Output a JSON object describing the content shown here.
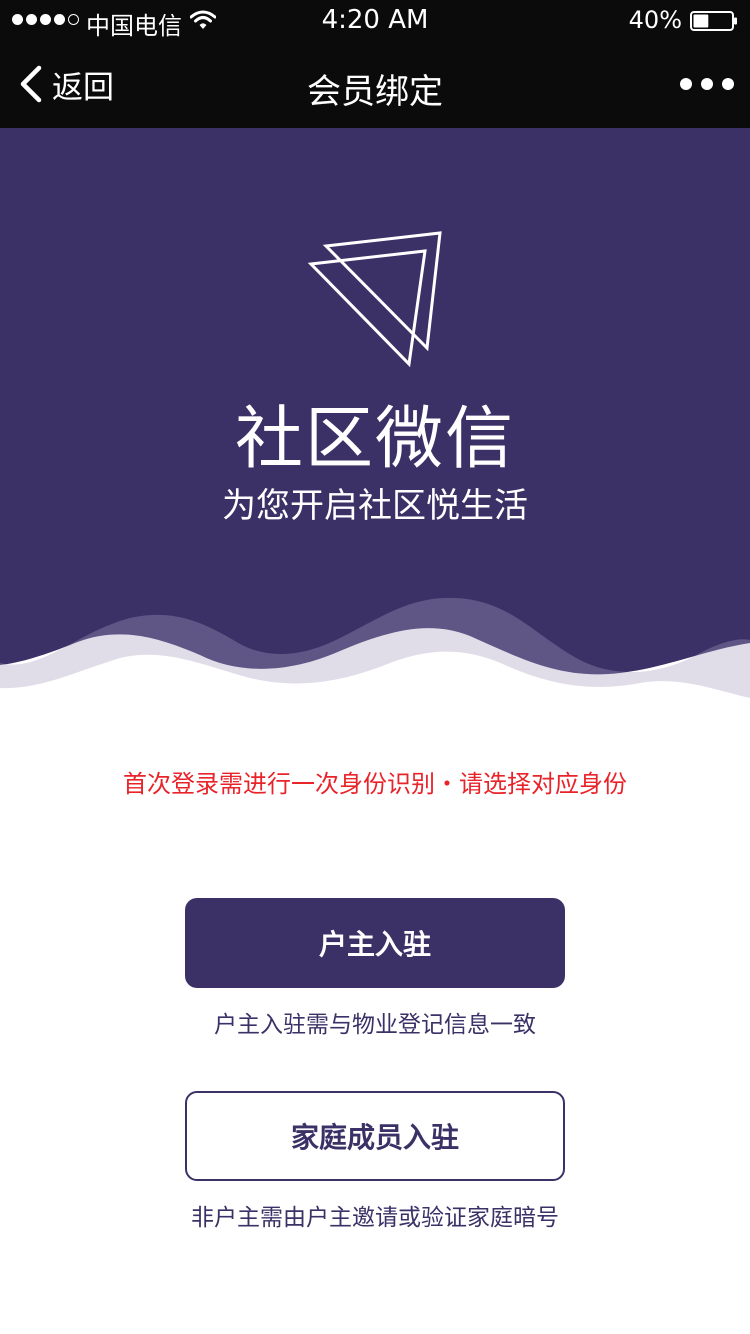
{
  "status_bar": {
    "carrier": "中国电信",
    "time": "4:20 AM",
    "battery": "40%",
    "battery_level": 0.4,
    "signal_bars_filled": 4,
    "signal_bars_total": 5
  },
  "nav": {
    "back_label": "返回",
    "title": "会员绑定"
  },
  "hero": {
    "title": "社区微信",
    "subtitle": "为您开启社区悦生活",
    "background_color": "#3b3167"
  },
  "notice": "首次登录需进行一次身份识别・请选择对应身份",
  "options": {
    "owner": {
      "label": "户主入驻",
      "hint": "户主入驻需与物业登记信息一致"
    },
    "family": {
      "label": "家庭成员入驻",
      "hint": "非户主需由户主邀请或验证家庭暗号"
    }
  },
  "colors": {
    "accent": "#3b3167",
    "notice": "#e8232a"
  }
}
